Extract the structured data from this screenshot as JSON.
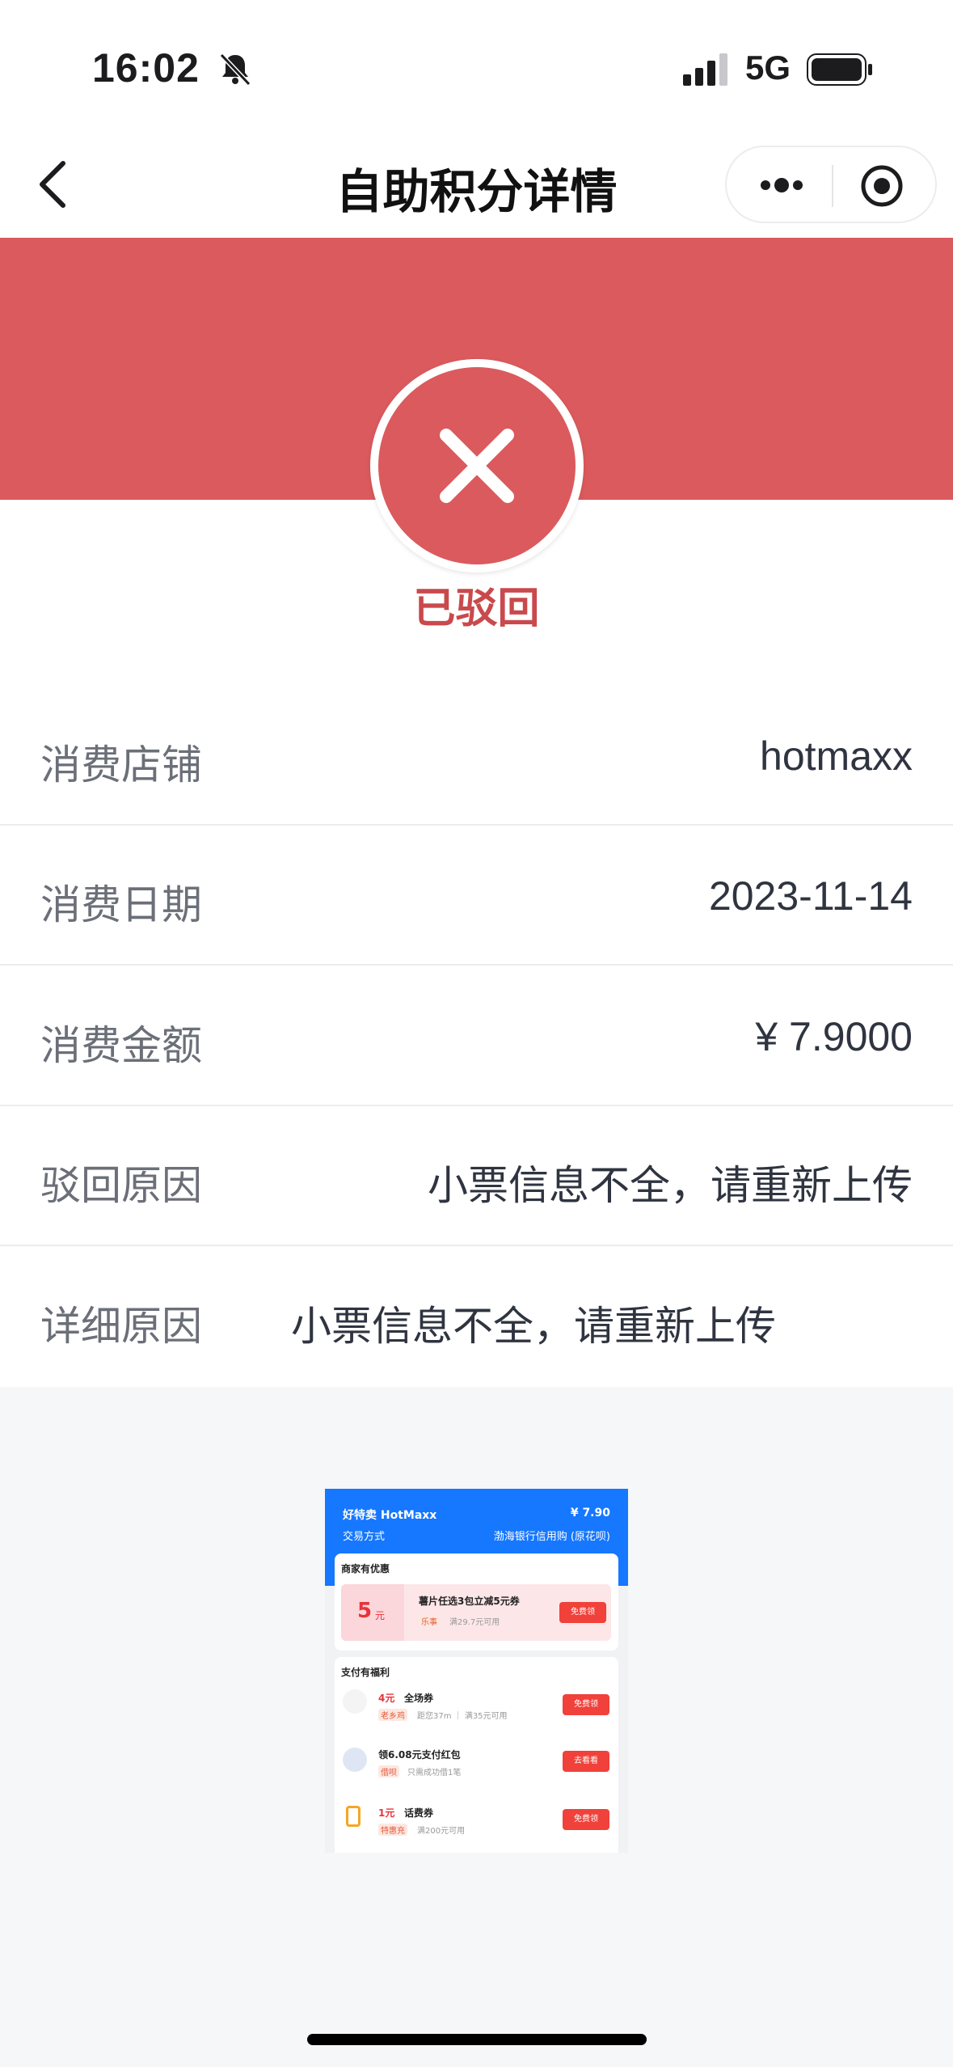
{
  "status_bar": {
    "time": "16:02",
    "network": "5G",
    "icons": [
      "bell-slash-icon",
      "signal-icon",
      "battery-icon"
    ]
  },
  "nav": {
    "title": "自助积分详情",
    "icons": [
      "back-chevron-icon",
      "more-dots-icon",
      "target-icon"
    ]
  },
  "status": {
    "label": "已驳回",
    "icon": "close-x-icon",
    "color": "#db5a5d"
  },
  "details": [
    {
      "label": "消费店铺",
      "value": "hotmaxx"
    },
    {
      "label": "消费日期",
      "value": "2023-11-14"
    },
    {
      "label": "消费金额",
      "value": "¥ 7.9000"
    },
    {
      "label": "驳回原因",
      "value": "小票信息不全，请重新上传"
    },
    {
      "label": "详细原因",
      "value": "小票信息不全，请重新上传"
    }
  ],
  "receipt": {
    "merchant": "好特卖 HotMaxx",
    "amount": "¥ 7.90",
    "pay_method_label": "交易方式",
    "pay_method": "渤海银行信用购 (原花呗)",
    "offers_title": "商家有优惠",
    "offer": {
      "amount": "5",
      "unit": "元",
      "title": "薯片任选3包立减5元券",
      "tag": "乐事",
      "condition": "满29.7元可用",
      "button": "免费领"
    },
    "benefits_title": "支付有福利",
    "benefits": [
      {
        "amount": "4元",
        "title": "全场券",
        "tag": "老乡鸡",
        "desc": "距您37m ｜ 满35元可用",
        "button": "免费领"
      },
      {
        "amount": "",
        "title": "领6.08元支付红包",
        "tag": "借呗",
        "desc": "只需成功借1笔",
        "button": "去看看"
      },
      {
        "amount": "1元",
        "title": "话费券",
        "tag": "特惠充",
        "desc": "满200元可用",
        "button": "免费领"
      }
    ]
  }
}
